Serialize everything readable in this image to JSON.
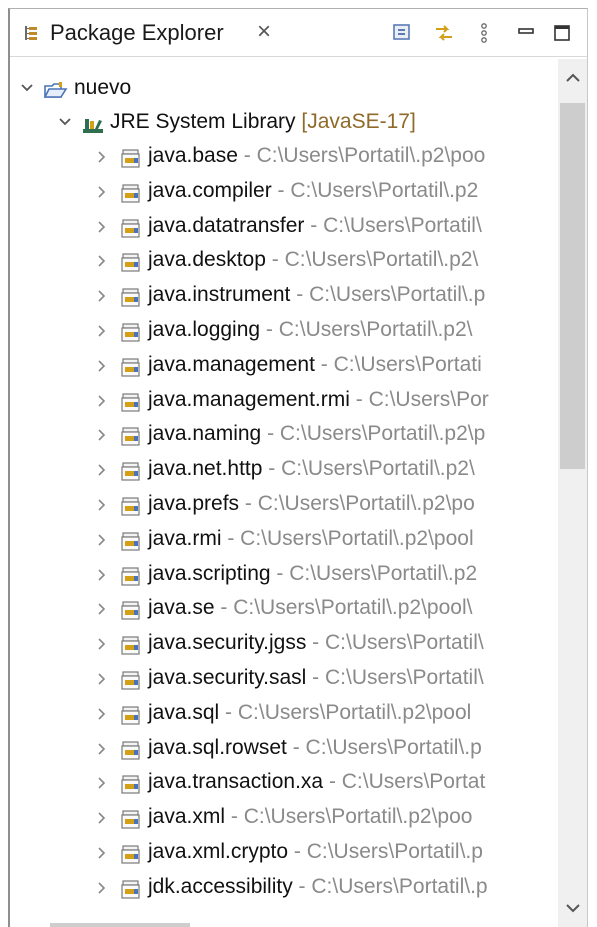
{
  "view": {
    "title": "Package Explorer",
    "close_glyph": "×",
    "icons": {
      "view_icon": "package-explorer-icon",
      "collapse_all": "collapse-all-icon",
      "link_with_editor": "link-with-editor-icon",
      "view_menu": "view-menu-icon",
      "minimize": "minimize-icon",
      "maximize": "maximize-icon"
    }
  },
  "tree": {
    "project": {
      "label": "nuevo",
      "expanded": true,
      "icon": "project-folder-icon"
    },
    "library": {
      "label": "JRE System Library",
      "decoration": "[JavaSE-17]",
      "expanded": true,
      "icon": "library-icon"
    },
    "modules": [
      {
        "name": "java.base",
        "path": " - C:\\Users\\Portatil\\.p2\\poo"
      },
      {
        "name": "java.compiler",
        "path": " - C:\\Users\\Portatil\\.p2"
      },
      {
        "name": "java.datatransfer",
        "path": " - C:\\Users\\Portatil\\"
      },
      {
        "name": "java.desktop",
        "path": " - C:\\Users\\Portatil\\.p2\\"
      },
      {
        "name": "java.instrument",
        "path": " - C:\\Users\\Portatil\\.p"
      },
      {
        "name": "java.logging",
        "path": " - C:\\Users\\Portatil\\.p2\\"
      },
      {
        "name": "java.management",
        "path": " - C:\\Users\\Portati"
      },
      {
        "name": "java.management.rmi",
        "path": " - C:\\Users\\Por"
      },
      {
        "name": "java.naming",
        "path": " - C:\\Users\\Portatil\\.p2\\p"
      },
      {
        "name": "java.net.http",
        "path": " - C:\\Users\\Portatil\\.p2\\"
      },
      {
        "name": "java.prefs",
        "path": " - C:\\Users\\Portatil\\.p2\\po"
      },
      {
        "name": "java.rmi",
        "path": " - C:\\Users\\Portatil\\.p2\\pool"
      },
      {
        "name": "java.scripting",
        "path": " - C:\\Users\\Portatil\\.p2"
      },
      {
        "name": "java.se",
        "path": " - C:\\Users\\Portatil\\.p2\\pool\\"
      },
      {
        "name": "java.security.jgss",
        "path": " - C:\\Users\\Portatil\\"
      },
      {
        "name": "java.security.sasl",
        "path": " - C:\\Users\\Portatil\\"
      },
      {
        "name": "java.sql",
        "path": " - C:\\Users\\Portatil\\.p2\\pool"
      },
      {
        "name": "java.sql.rowset",
        "path": " - C:\\Users\\Portatil\\.p"
      },
      {
        "name": "java.transaction.xa",
        "path": " - C:\\Users\\Portat"
      },
      {
        "name": "java.xml",
        "path": " - C:\\Users\\Portatil\\.p2\\poo"
      },
      {
        "name": "java.xml.crypto",
        "path": " - C:\\Users\\Portatil\\.p"
      },
      {
        "name": "jdk.accessibility",
        "path": " - C:\\Users\\Portatil\\.p"
      }
    ],
    "module_icon": "jar-module-icon",
    "collapsed_arrow": "chevron-right-icon",
    "expanded_arrow": "chevron-down-icon"
  },
  "colors": {
    "decoration": "#8f6a2a",
    "path": "#8a8a8a",
    "library_books": "#2f6f4f",
    "folder": "#4a73b8"
  }
}
